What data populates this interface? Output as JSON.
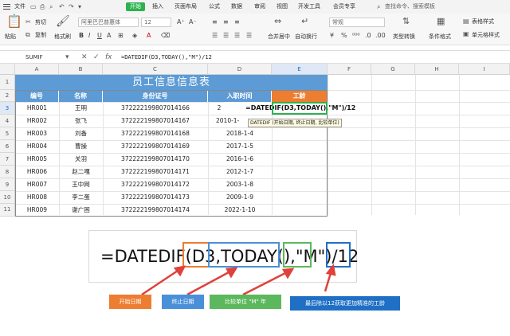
{
  "menu": {
    "file": "文件",
    "items": [
      "开始",
      "插入",
      "页面布局",
      "公式",
      "数据",
      "审阅",
      "视图",
      "开发工具",
      "会员专享"
    ],
    "search": "查找命令、搜索模板"
  },
  "toolbar": {
    "cut": "剪切",
    "copy": "复制",
    "paste": "粘贴",
    "format_painter": "格式刷",
    "font_name": "阿里巴巴普惠体",
    "font_size": "12",
    "merge_center": "合并居中",
    "auto_wrap": "自动换行",
    "number_format": "常规",
    "type_convert": "类型转换",
    "conditional_format": "条件格式",
    "table_style": "表格样式",
    "cell_style": "单元格样式"
  },
  "formula_bar": {
    "name_box": "SUMIF",
    "formula": "=DATEDIF(D3,TODAY(),\"M\")/12"
  },
  "columns": [
    "A",
    "B",
    "C",
    "D",
    "E",
    "F",
    "G",
    "H",
    "I"
  ],
  "rows": [
    "1",
    "2",
    "3",
    "4",
    "5",
    "6",
    "7",
    "8",
    "9",
    "10",
    "11"
  ],
  "table": {
    "title": "员工信息信息表",
    "headers": [
      "编号",
      "名称",
      "身份证号",
      "入职时间",
      "工龄"
    ],
    "data": [
      [
        "HR001",
        "王明",
        "372222199807014166",
        "2"
      ],
      [
        "HR002",
        "张飞",
        "372222199807014167",
        "2010-1-"
      ],
      [
        "HR003",
        "刘备",
        "372222199807014168",
        "2018-1-4"
      ],
      [
        "HR004",
        "曹操",
        "372222199807014169",
        "2017-1-5"
      ],
      [
        "HR005",
        "关羽",
        "372222199807014170",
        "2016-1-6"
      ],
      [
        "HR006",
        "赵二嘎",
        "372222199807014171",
        "2012-1-7"
      ],
      [
        "HR007",
        "王中网",
        "372222199807014172",
        "2003-1-8"
      ],
      [
        "HR008",
        "李二蛋",
        "372222199807014173",
        "2009-1-9"
      ],
      [
        "HR009",
        "谢广困",
        "372222199807014174",
        "2022-1-10"
      ]
    ]
  },
  "editing": {
    "formula": "=DATEDIF(D3,TODAY(),\"M\")/12",
    "tooltip": "DATEDIF (开始日期, 终止日期, 比较单位)"
  },
  "annotation": {
    "big_formula": "=DATEDIF(D3,TODAY(),\"M\")/12",
    "labels": {
      "start": "开始日期",
      "end": "终止日期",
      "unit": "比较单位 \"M\" 年",
      "note": "最后除以12获取更加精准的工龄"
    },
    "colors": {
      "start": "#ed7d31",
      "end": "#4a90d9",
      "unit": "#5cb85c",
      "note": "#1f6fc5",
      "arrow": "#e0413a"
    }
  },
  "colors": {
    "header_blue": "#5c9bd5",
    "header_orange": "#ed7d31",
    "accent_green": "#2cb24f"
  }
}
